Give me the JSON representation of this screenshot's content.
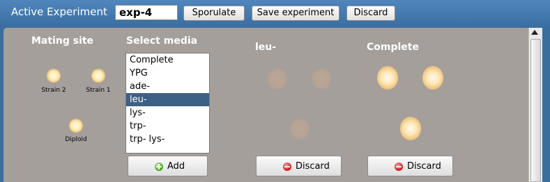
{
  "header": {
    "title": "Active Experiment",
    "experiment_value": "exp-4",
    "sporulate_label": "Sporulate",
    "save_label": "Save experiment",
    "discard_label": "Discard"
  },
  "mating": {
    "heading": "Mating site",
    "strain2_label": "Strain 2",
    "strain1_label": "Strain 1",
    "diploid_label": "Diploid"
  },
  "media": {
    "heading": "Select media",
    "options": [
      "Complete",
      "YPG",
      "ade-",
      "leu-",
      "lys-",
      "trp-",
      "trp- lys-"
    ],
    "selected": "leu-",
    "add_label": "Add"
  },
  "plates": [
    {
      "heading": "leu-",
      "discard_label": "Discard",
      "growth": "none"
    },
    {
      "heading": "Complete",
      "discard_label": "Discard",
      "growth": "grown"
    }
  ],
  "icons": {
    "add": "add-icon",
    "discard": "discard-icon",
    "scroll": "scroll-up-arrow-icon"
  },
  "colors": {
    "header_bg": "#3a6e9e",
    "panel_bg": "#a59f9c",
    "selection": "#3d6185"
  }
}
